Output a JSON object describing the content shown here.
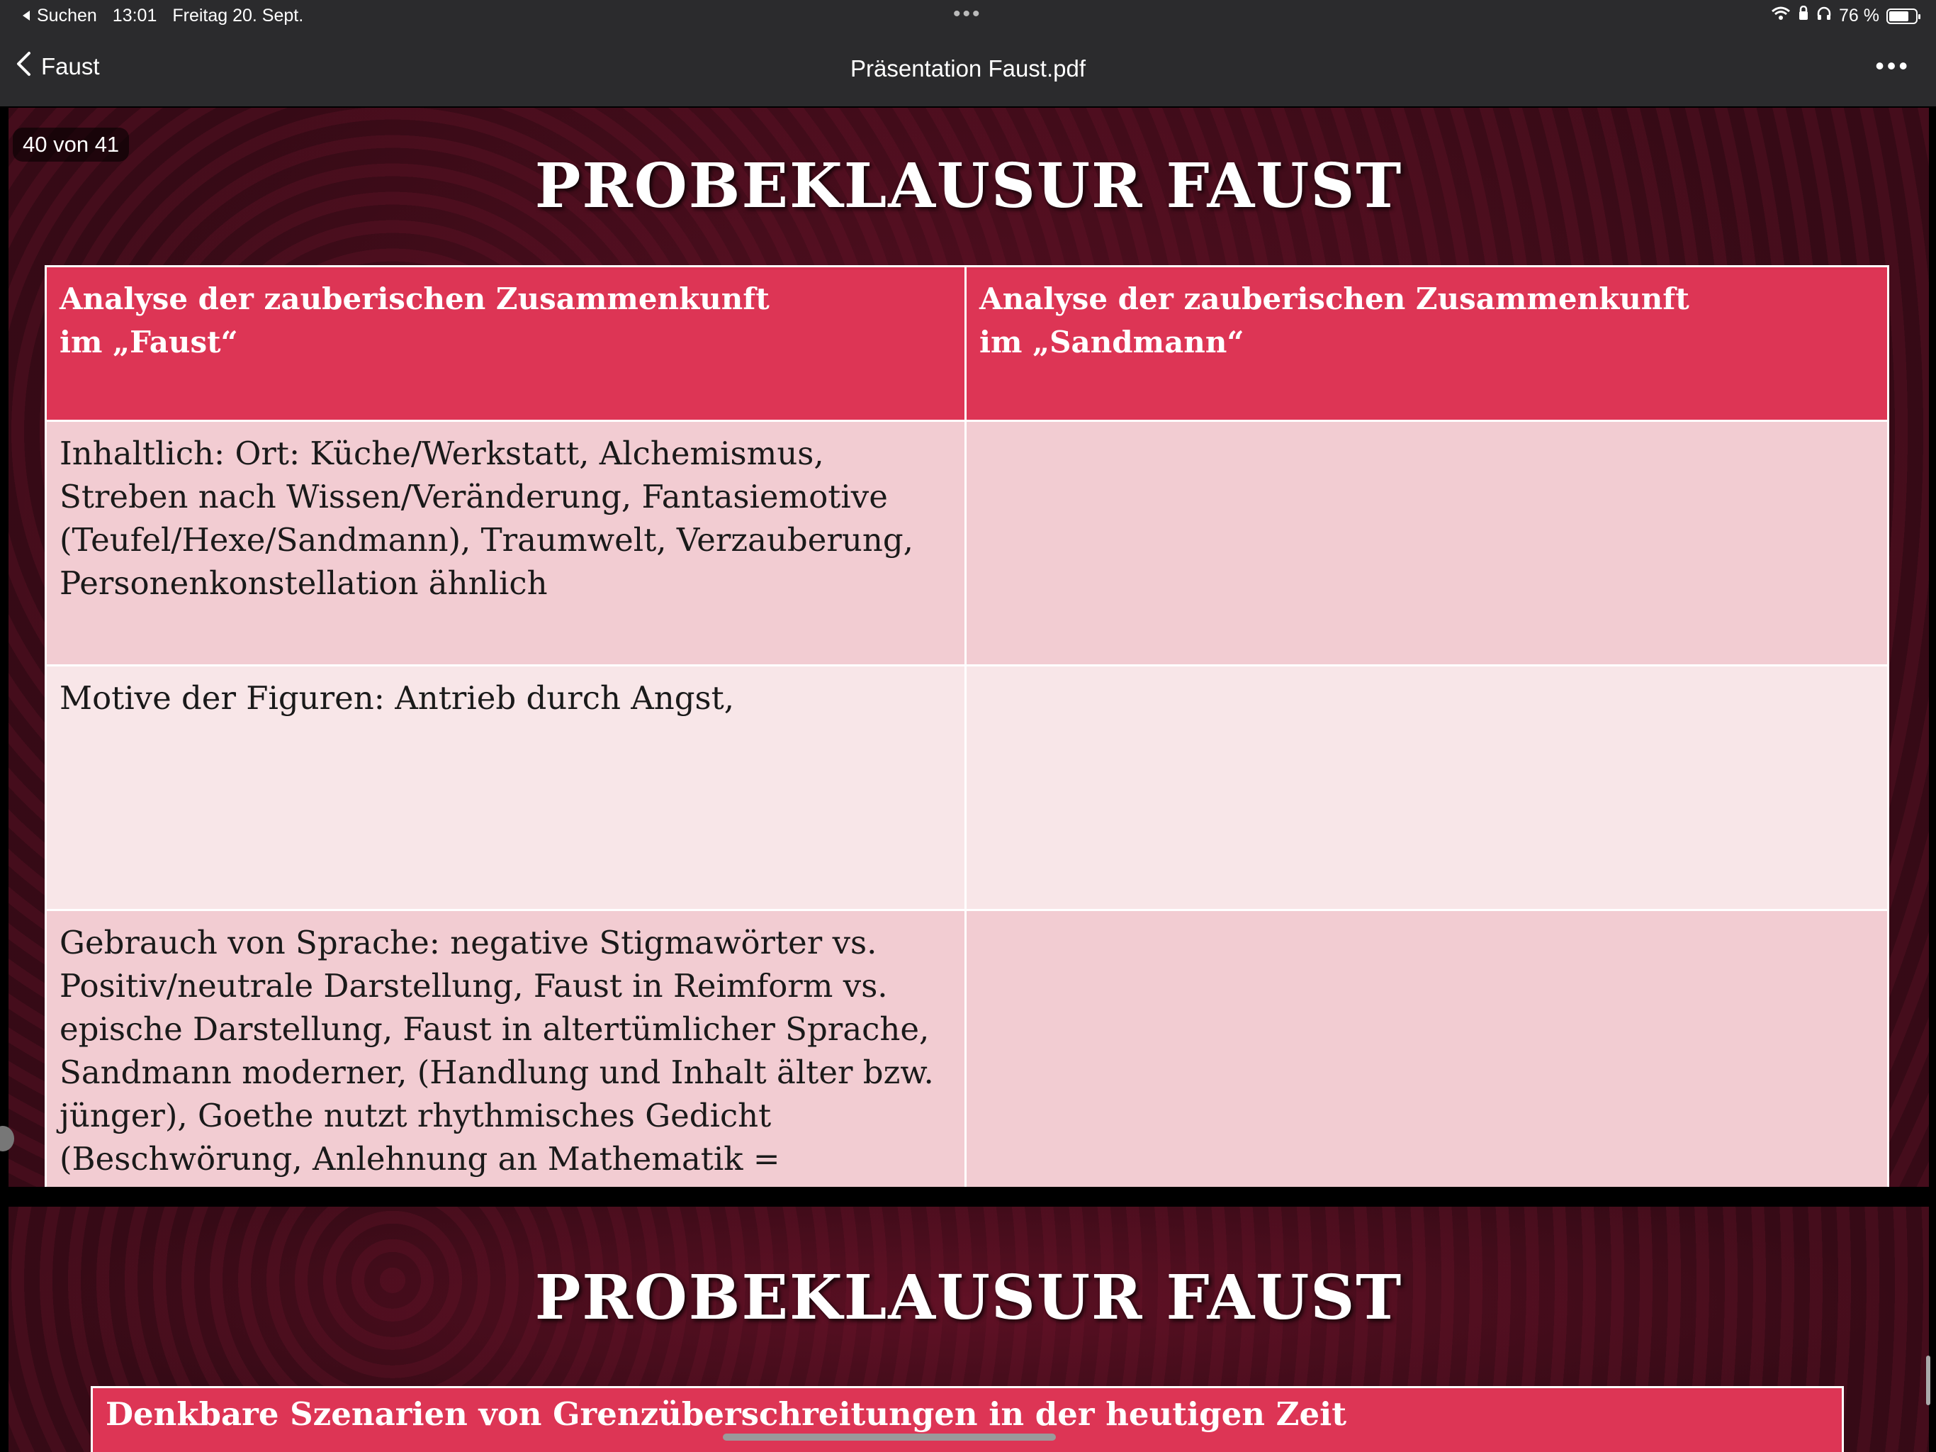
{
  "status_bar": {
    "back_app": "Suchen",
    "time": "13:01",
    "date": "Freitag 20. Sept.",
    "battery": "76 %",
    "battery_level": 0.76
  },
  "nav": {
    "back_label": "Faust",
    "title": "Präsentation Faust.pdf"
  },
  "page_indicator": "40 von 41",
  "slide1": {
    "title": "PROBEKLAUSUR FAUST",
    "headers": [
      "Analyse der zauberischen Zusammenkunft\nim „Faust“",
      "Analyse der zauberischen Zusammenkunft\nim „Sandmann“"
    ],
    "rows": [
      {
        "faust": "Inhaltlich: Ort: Küche/Werkstatt, Alchemismus,\nStreben nach Wissen/Veränderung, Fantasiemotive\n(Teufel/Hexe/Sandmann), Traumwelt, Verzauberung,\nPersonenkonstellation ähnlich",
        "sandmann": ""
      },
      {
        "faust": "Motive der Figuren: Antrieb durch Angst,",
        "sandmann": ""
      },
      {
        "faust": "Gebrauch von Sprache: negative Stigmawörter vs.\nPositiv/neutrale Darstellung, Faust in Reimform vs.\nepische Darstellung, Faust in altertümlicher Sprache,\nSandmann moderner, (Handlung und Inhalt älter bzw.\njünger), Goethe nutzt rhythmisches Gedicht\n(Beschwörung, Anlehnung an Mathematik =",
        "sandmann": ""
      }
    ]
  },
  "slide2": {
    "title": "PROBEKLAUSUR FAUST",
    "box_heading": "Denkbare Szenarien von Grenzüberschreitungen in der heutigen Zeit"
  },
  "colors": {
    "bars": "#2b2b2d",
    "header_red": "#dd3555",
    "row_dark": "#f2ccd2",
    "row_light": "#f8e6e8",
    "slide_bg": "#3a0c18"
  }
}
